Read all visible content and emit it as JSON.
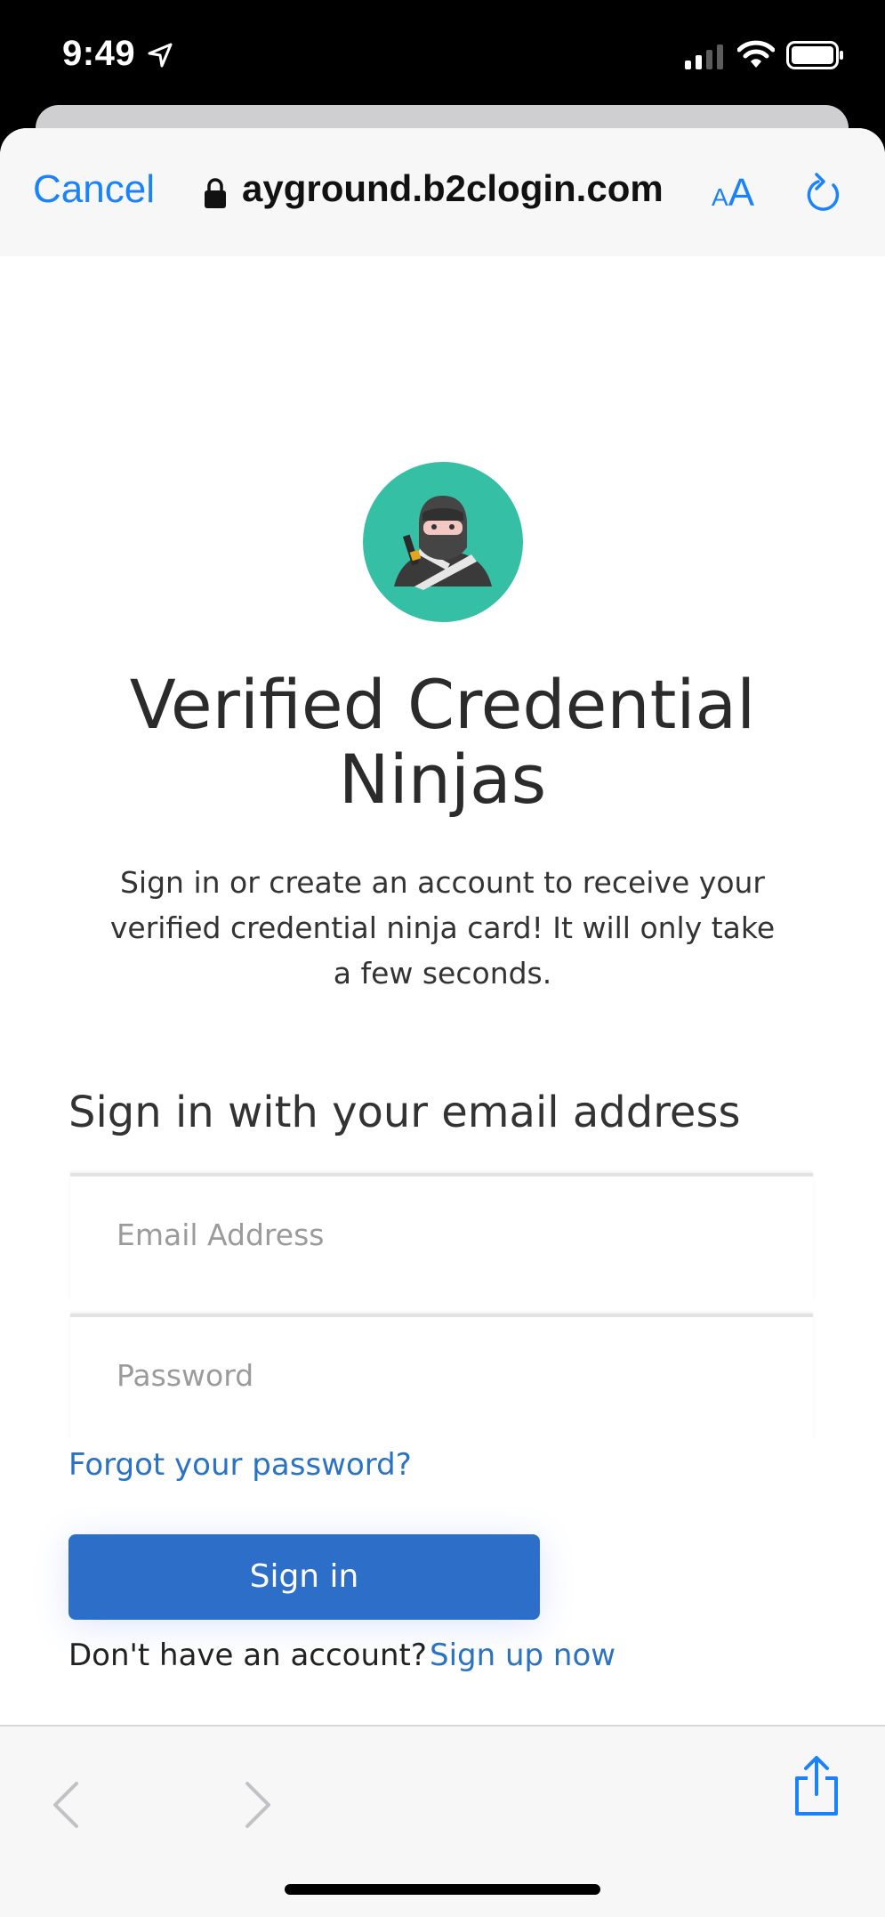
{
  "status_bar": {
    "time": "9:49"
  },
  "browser": {
    "cancel_label": "Cancel",
    "url": "ayground.b2clogin.com",
    "text_size_small": "A",
    "text_size_large": "A"
  },
  "page": {
    "logo_icon": "ninja-logo-icon",
    "title": "Verified Credential Ninjas",
    "intro": "Sign in or create an account to receive your verified credential ninja card! It will only take a few seconds.",
    "section_heading": "Sign in with your email address",
    "email_placeholder": "Email Address",
    "password_placeholder": "Password",
    "forgot_password": "Forgot your password?",
    "sign_in": "Sign in",
    "no_account": "Don't have an account?",
    "sign_up": "Sign up now"
  },
  "colors": {
    "link": "#2a72c3",
    "button": "#2d6ec8",
    "ios_blue": "#1a82fb",
    "logo_bg": "#35bfa4"
  }
}
